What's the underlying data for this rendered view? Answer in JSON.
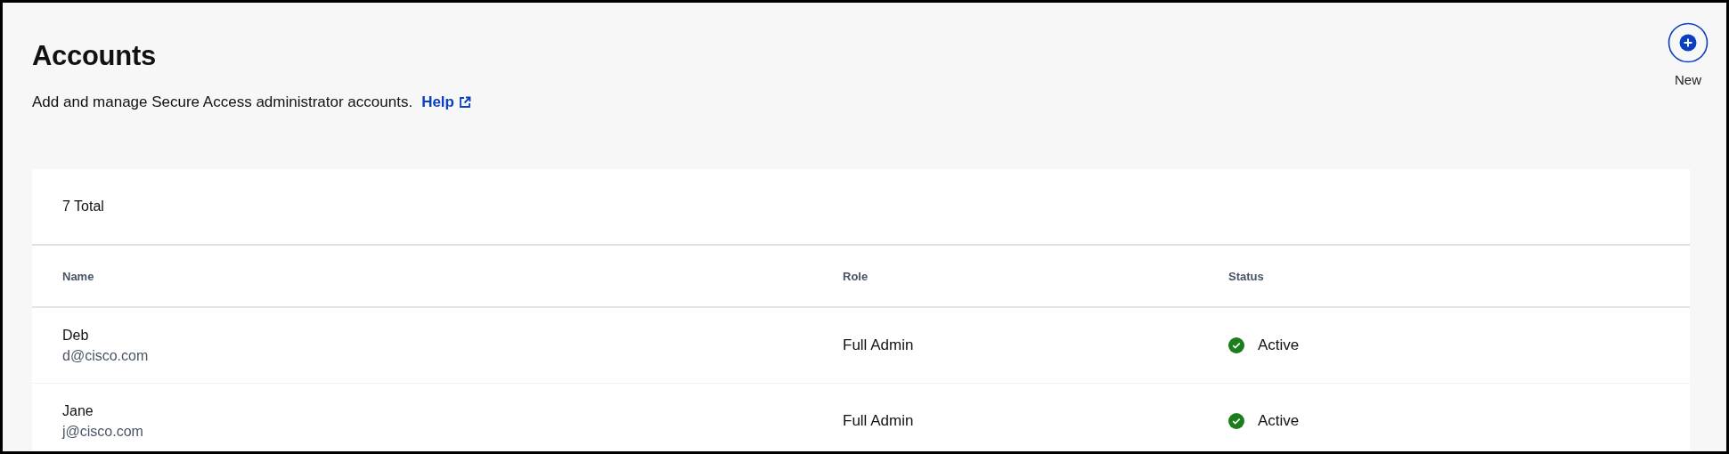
{
  "page": {
    "title": "Accounts",
    "description": "Add and manage Secure Access administrator accounts.",
    "help_link": "Help"
  },
  "new_button": {
    "label": "New"
  },
  "table": {
    "total": "7 Total",
    "columns": [
      "Name",
      "Role",
      "Status"
    ],
    "rows": [
      {
        "name": "Deb",
        "email": "d@cisco.com",
        "role": "Full Admin",
        "status": {
          "kind": "active",
          "label": "Active"
        }
      },
      {
        "name": "Jane",
        "email": "j@cisco.com",
        "role": "Full Admin",
        "status": {
          "kind": "active",
          "label": "Active"
        }
      }
    ]
  }
}
